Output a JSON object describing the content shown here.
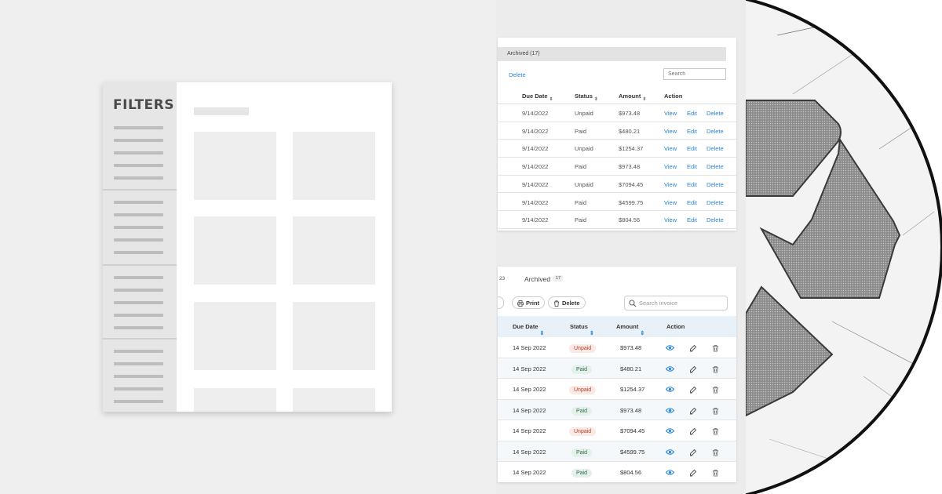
{
  "filters_panel": {
    "title": "FILTERS"
  },
  "old_table": {
    "tab_label": "Archived (17)",
    "delete_link": "Delete",
    "search_placeholder": "Search",
    "columns": [
      "Due Date",
      "Status",
      "Amount",
      "Action"
    ],
    "actions": [
      "View",
      "Edit",
      "Delete"
    ],
    "rows": [
      {
        "date": "9/14/2022",
        "status": "Unpaid",
        "amount": "$973.48"
      },
      {
        "date": "9/14/2022",
        "status": "Paid",
        "amount": "$480.21"
      },
      {
        "date": "9/14/2022",
        "status": "Unpaid",
        "amount": "$1254.37"
      },
      {
        "date": "9/14/2022",
        "status": "Paid",
        "amount": "$973.48"
      },
      {
        "date": "9/14/2022",
        "status": "Unpaid",
        "amount": "$7094.45"
      },
      {
        "date": "9/14/2022",
        "status": "Paid",
        "amount": "$4599.75"
      },
      {
        "date": "9/14/2022",
        "status": "Paid",
        "amount": "$804.56"
      }
    ]
  },
  "new_table": {
    "tab_count": "23",
    "tab_archived": "Archived",
    "tab_archived_badge": "17",
    "print_label": "Print",
    "delete_label": "Delete",
    "search_placeholder": "Search invoice",
    "columns": [
      "Due Date",
      "Status",
      "Amount",
      "Action"
    ],
    "rows": [
      {
        "date": "14 Sep 2022",
        "status": "Unpaid",
        "amount": "$973.48"
      },
      {
        "date": "14 Sep 2022",
        "status": "Paid",
        "amount": "$480.21"
      },
      {
        "date": "14 Sep 2022",
        "status": "Unpaid",
        "amount": "$1254.37"
      },
      {
        "date": "14 Sep 2022",
        "status": "Paid",
        "amount": "$973.48"
      },
      {
        "date": "14 Sep 2022",
        "status": "Unpaid",
        "amount": "$7094.45"
      },
      {
        "date": "14 Sep 2022",
        "status": "Paid",
        "amount": "$4599.75"
      },
      {
        "date": "14 Sep 2022",
        "status": "Paid",
        "amount": "$804.56"
      }
    ]
  },
  "icons": [
    "print-icon",
    "trash-icon",
    "search-icon",
    "eye-icon",
    "edit-icon",
    "recycle-icon"
  ],
  "colors": {
    "link_blue": "#2a86d6",
    "unpaid_pill_bg": "#fbe9e5",
    "paid_pill_bg": "#e3f1ea",
    "header_blue": "#e9f1f8"
  }
}
